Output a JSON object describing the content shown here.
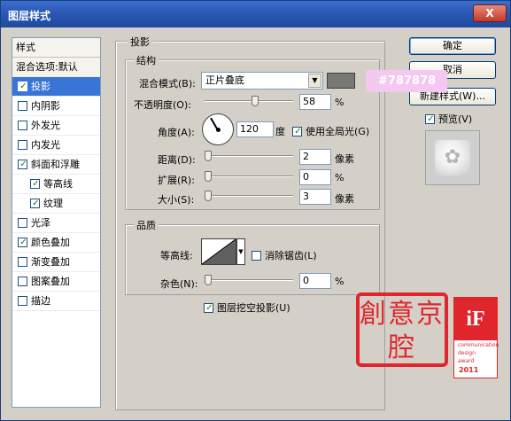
{
  "window": {
    "title": "图层样式",
    "close": "X"
  },
  "styles": {
    "header": "样式",
    "blend_options": "混合选项:默认",
    "items": [
      {
        "label": "投影",
        "checked": true,
        "selected": true,
        "sub": false
      },
      {
        "label": "内阴影",
        "checked": false,
        "selected": false,
        "sub": false
      },
      {
        "label": "外发光",
        "checked": false,
        "selected": false,
        "sub": false
      },
      {
        "label": "内发光",
        "checked": false,
        "selected": false,
        "sub": false
      },
      {
        "label": "斜面和浮雕",
        "checked": true,
        "selected": false,
        "sub": false
      },
      {
        "label": "等高线",
        "checked": true,
        "selected": false,
        "sub": true
      },
      {
        "label": "纹理",
        "checked": true,
        "selected": false,
        "sub": true
      },
      {
        "label": "光泽",
        "checked": false,
        "selected": false,
        "sub": false
      },
      {
        "label": "颜色叠加",
        "checked": true,
        "selected": false,
        "sub": false
      },
      {
        "label": "渐变叠加",
        "checked": false,
        "selected": false,
        "sub": false
      },
      {
        "label": "图案叠加",
        "checked": false,
        "selected": false,
        "sub": false
      },
      {
        "label": "描边",
        "checked": false,
        "selected": false,
        "sub": false
      }
    ]
  },
  "drop_shadow": {
    "title": "投影",
    "structure": {
      "title": "结构",
      "blend_mode_label": "混合模式(B):",
      "blend_mode_value": "正片叠底",
      "shadow_color": "#787878",
      "opacity_label": "不透明度(O):",
      "opacity_value": "58",
      "opacity_unit": "%",
      "opacity_level": 0.58,
      "angle_label": "角度(A):",
      "angle_value": "120",
      "angle_unit": "度",
      "global_light_label": "使用全局光(G)",
      "global_light_checked": true,
      "distance_label": "距离(D):",
      "distance_value": "2",
      "distance_unit": "像素",
      "spread_label": "扩展(R):",
      "spread_value": "0",
      "spread_unit": "%",
      "size_label": "大小(S):",
      "size_value": "3",
      "size_unit": "像素"
    },
    "quality": {
      "title": "品质",
      "contour_label": "等高线:",
      "antialias_label": "消除锯齿(L)",
      "antialias_checked": false,
      "noise_label": "杂色(N):",
      "noise_value": "0",
      "noise_unit": "%"
    },
    "knockout_label": "图层挖空投影(U)",
    "knockout_checked": true
  },
  "buttons": {
    "ok": "确定",
    "cancel": "取消",
    "new_style": "新建样式(W)...",
    "preview_label": "预览(V)",
    "preview_checked": true
  },
  "tooltip": {
    "text": "#787878"
  },
  "stamp": {
    "text": "創意京腔"
  },
  "award": {
    "logo": "iF",
    "line1": "communication",
    "line2": "design",
    "line3": "award",
    "year": "2011"
  }
}
